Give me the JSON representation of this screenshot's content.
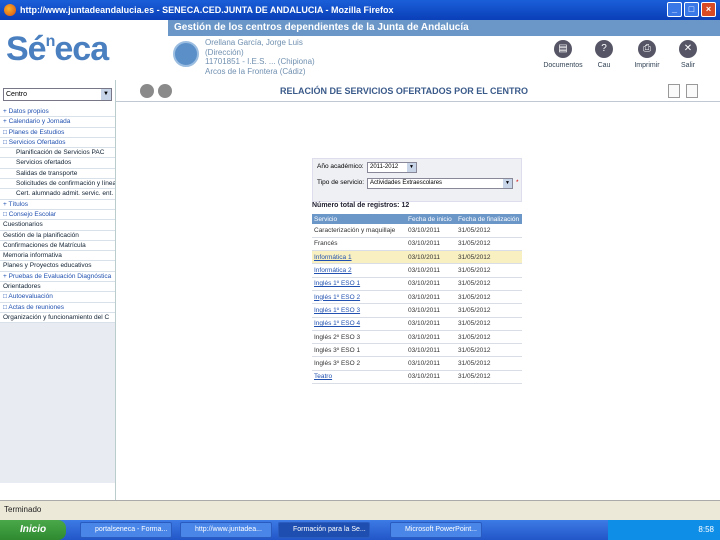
{
  "window": {
    "title": "http://www.juntadeandalucia.es - SENECA.CED.JUNTA DE ANDALUCIA - Mozilla Firefox"
  },
  "header": {
    "band_title": "Gestión de los centros dependientes de la Junta de Andalucía",
    "logo": "Séneca",
    "user_lines": [
      "Orellana García, Jorge Luis",
      "(Dirección)",
      "11701851 - I.E.S. ... (Chipiona)",
      "Arcos de la Frontera (Cádiz)"
    ],
    "tools": [
      {
        "label": "Documentos",
        "icon": "documents-icon"
      },
      {
        "label": "Cau",
        "icon": "help-icon"
      },
      {
        "label": "Imprimir",
        "icon": "printer-icon"
      },
      {
        "label": "Salir",
        "icon": "exit-icon"
      }
    ]
  },
  "sidebar": {
    "select_value": "Centro",
    "items": [
      {
        "label": "+ Datos propios",
        "kind": "top"
      },
      {
        "label": "+ Calendario y Jornada",
        "kind": "top"
      },
      {
        "label": "□ Planes de Estudios",
        "kind": "top"
      },
      {
        "label": "□ Servicios Ofertados",
        "kind": "top"
      },
      {
        "label": "Planificación de Servicios PAC",
        "kind": "sub"
      },
      {
        "label": "Servicios ofertados",
        "kind": "sub"
      },
      {
        "label": "Salidas de transporte",
        "kind": "sub"
      },
      {
        "label": "Solicitudes de confirmación y línea",
        "kind": "sub"
      },
      {
        "label": "Cert. alumnado admit. servic. ent.",
        "kind": "sub"
      },
      {
        "label": "+ Títulos",
        "kind": "top"
      },
      {
        "label": "□ Consejo Escolar",
        "kind": "top"
      },
      {
        "label": "Cuestionarios",
        "kind": "plain"
      },
      {
        "label": "Gestión de la planificación",
        "kind": "plain"
      },
      {
        "label": "Confirmaciones de Matrícula",
        "kind": "plain"
      },
      {
        "label": "Memoria informativa",
        "kind": "plain"
      },
      {
        "label": "Planes y Proyectos educativos",
        "kind": "plain"
      },
      {
        "label": "+ Pruebas de Evaluación Diagnóstica",
        "kind": "top"
      },
      {
        "label": "Orientadores",
        "kind": "plain"
      },
      {
        "label": "□ Autoevaluación",
        "kind": "top"
      },
      {
        "label": "□ Actas de reuniones",
        "kind": "top"
      },
      {
        "label": "Organización y funcionamiento del C",
        "kind": "plain"
      }
    ]
  },
  "main": {
    "title": "RELACIÓN DE SERVICIOS OFERTADOS POR EL CENTRO",
    "form": {
      "year_label": "Año académico:",
      "year_value": "2011-2012",
      "type_label": "Tipo de servicio:",
      "type_value": "Actividades Extraescolares",
      "required_mark": "*"
    },
    "total_label": "Número total de registros: 12",
    "table": {
      "headers": [
        "Servicio",
        "Fecha de inicio",
        "Fecha de finalización"
      ],
      "rows": [
        {
          "service": "Caracterización y maquillaje",
          "start": "03/10/2011",
          "end": "31/05/2012",
          "link": false,
          "highlight": false
        },
        {
          "service": "Francés",
          "start": "03/10/2011",
          "end": "31/05/2012",
          "link": false,
          "highlight": false
        },
        {
          "service": "Informática 1",
          "start": "03/10/2011",
          "end": "31/05/2012",
          "link": true,
          "highlight": true
        },
        {
          "service": "Informática 2",
          "start": "03/10/2011",
          "end": "31/05/2012",
          "link": true,
          "highlight": false
        },
        {
          "service": "Inglés 1º ESO 1",
          "start": "03/10/2011",
          "end": "31/05/2012",
          "link": true,
          "highlight": false
        },
        {
          "service": "Inglés 1º ESO 2",
          "start": "03/10/2011",
          "end": "31/05/2012",
          "link": true,
          "highlight": false
        },
        {
          "service": "Inglés 1º ESO 3",
          "start": "03/10/2011",
          "end": "31/05/2012",
          "link": true,
          "highlight": false
        },
        {
          "service": "Inglés 1º ESO 4",
          "start": "03/10/2011",
          "end": "31/05/2012",
          "link": true,
          "highlight": false
        },
        {
          "service": "Inglés 2º ESO 3",
          "start": "03/10/2011",
          "end": "31/05/2012",
          "link": false,
          "highlight": false
        },
        {
          "service": "Inglés 3º ESO 1",
          "start": "03/10/2011",
          "end": "31/05/2012",
          "link": false,
          "highlight": false
        },
        {
          "service": "Inglés 3º ESO 2",
          "start": "03/10/2011",
          "end": "31/05/2012",
          "link": false,
          "highlight": false
        },
        {
          "service": "Teatro",
          "start": "03/10/2011",
          "end": "31/05/2012",
          "link": true,
          "highlight": false
        }
      ]
    }
  },
  "status": "Terminado",
  "taskbar": {
    "start": "Inicio",
    "tasks": [
      "portalseneca - Forma...",
      "http://www.juntadea...",
      "Formación para la Se...",
      "Microsoft PowerPoint..."
    ],
    "clock": "8:58"
  }
}
